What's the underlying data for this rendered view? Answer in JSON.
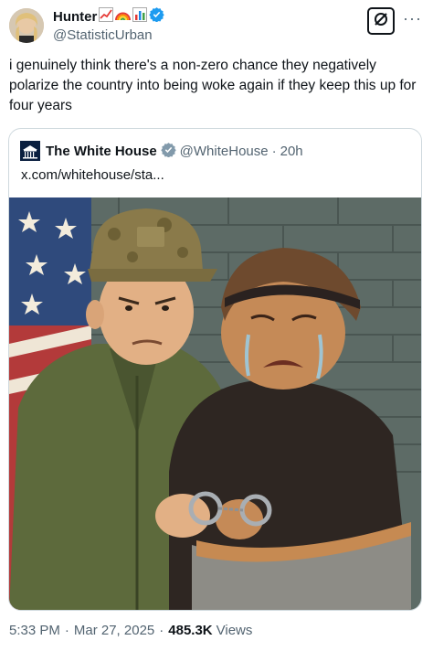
{
  "author": {
    "display_name": "Hunter",
    "handle": "@StatisticUrban",
    "avatar_icon": "avatar-photo",
    "name_emojis": [
      "chart-increasing-emoji",
      "rainbow-emoji",
      "bar-chart-emoji"
    ],
    "verified_color": "#1d9bf0"
  },
  "actions": {
    "grok_icon": "grok-icon",
    "more_label": "···"
  },
  "tweet": {
    "text": "i genuinely think there's a non-zero chance they negatively polarize the country into being woke again if they keep this up for four years"
  },
  "quoted": {
    "display_name": "The White House",
    "handle": "@WhiteHouse",
    "separator": "·",
    "time": "20h",
    "link_text": "x.com/whitehouse/sta...",
    "verified_color": "#829aab",
    "image_description_icon": "cartoon-illustration"
  },
  "meta": {
    "time": "5:33 PM",
    "separator": "·",
    "date": "Mar 27, 2025",
    "views_count": "485.3K",
    "views_label": "Views"
  }
}
